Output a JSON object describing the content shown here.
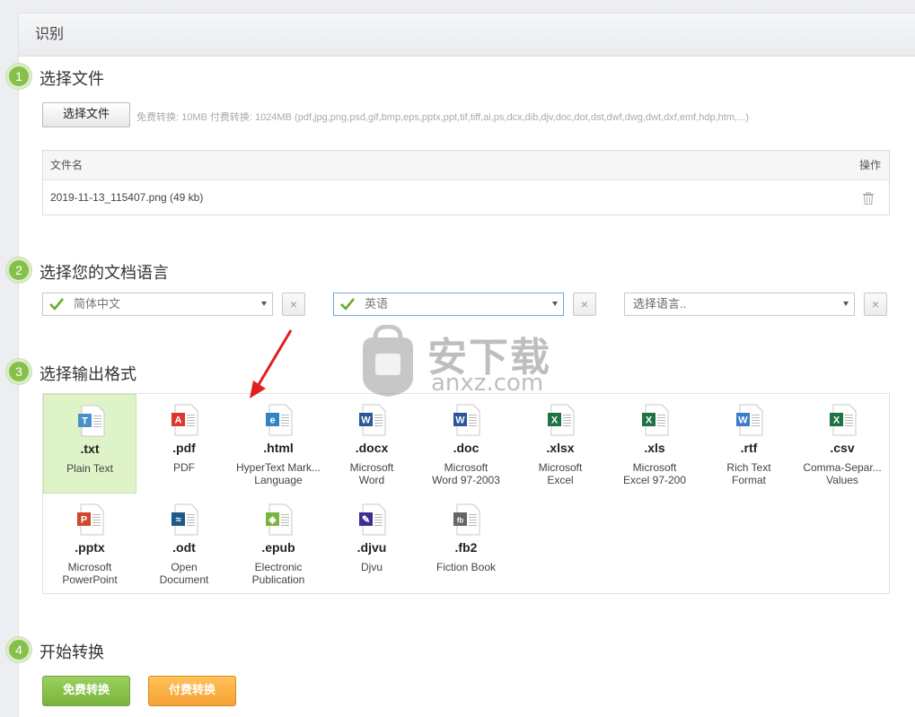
{
  "header": {
    "title": "识别"
  },
  "step1": {
    "number": "1",
    "title": "选择文件",
    "choose_label": "选择文件",
    "limits": "免费转换: 10MB  付费转换: 1024MB   (pdf,jpg,png,psd,gif,bmp,eps,pptx,ppt,tif,tiff,ai,ps,dcx,dib,djv,doc,dot,dst,dwf,dwg,dwt,dxf,emf,hdp,htm,...)",
    "table": {
      "col_name": "文件名",
      "col_action": "操作",
      "rows": [
        {
          "name": "2019-11-13_115407.png (49 kb)"
        }
      ]
    }
  },
  "step2": {
    "number": "2",
    "title": "选择您的文档语言",
    "selects": [
      {
        "value": "简体中文"
      },
      {
        "value": "英语"
      },
      {
        "value": "选择语言.."
      }
    ],
    "clear_label": "×"
  },
  "step3": {
    "number": "3",
    "title": "选择输出格式",
    "formats": [
      {
        "ext": ".txt",
        "line1": "Plain Text",
        "line2": "",
        "icon": "txt-file-icon",
        "color": "#4a90c8",
        "letter": "T"
      },
      {
        "ext": ".pdf",
        "line1": "PDF",
        "line2": "",
        "icon": "pdf-file-icon",
        "color": "#d9382f",
        "letter": "A"
      },
      {
        "ext": ".html",
        "line1": "HyperText Mark...",
        "line2": "Language",
        "icon": "html-file-icon",
        "color": "#2f86c7",
        "letter": "e"
      },
      {
        "ext": ".docx",
        "line1": "Microsoft",
        "line2": "Word",
        "icon": "word-file-icon",
        "color": "#2b5797",
        "letter": "W"
      },
      {
        "ext": ".doc",
        "line1": "Microsoft",
        "line2": "Word 97-2003",
        "icon": "word-file-icon",
        "color": "#2b5797",
        "letter": "W"
      },
      {
        "ext": ".xlsx",
        "line1": "Microsoft",
        "line2": "Excel",
        "icon": "excel-file-icon",
        "color": "#1f7244",
        "letter": "X"
      },
      {
        "ext": ".xls",
        "line1": "Microsoft",
        "line2": "Excel 97-200",
        "icon": "excel-file-icon",
        "color": "#1f7244",
        "letter": "X"
      },
      {
        "ext": ".rtf",
        "line1": "Rich Text",
        "line2": "Format",
        "icon": "rtf-file-icon",
        "color": "#3a7dc9",
        "letter": "W"
      },
      {
        "ext": ".csv",
        "line1": "Comma-Separ...",
        "line2": "Values",
        "icon": "csv-file-icon",
        "color": "#1f7244",
        "letter": "X"
      },
      {
        "ext": ".pptx",
        "line1": "Microsoft",
        "line2": "PowerPoint",
        "icon": "powerpoint-file-icon",
        "color": "#d0472b",
        "letter": "P"
      },
      {
        "ext": ".odt",
        "line1": "Open",
        "line2": "Document",
        "icon": "odt-file-icon",
        "color": "#1d5a8a",
        "letter": "≈"
      },
      {
        "ext": ".epub",
        "line1": "Electronic",
        "line2": "Publication",
        "icon": "epub-file-icon",
        "color": "#7ab33d",
        "letter": "◈"
      },
      {
        "ext": ".djvu",
        "line1": "Djvu",
        "line2": "",
        "icon": "djvu-file-icon",
        "color": "#3b2f8f",
        "letter": "✎"
      },
      {
        "ext": ".fb2",
        "line1": "Fiction Book",
        "line2": "",
        "icon": "fb2-file-icon",
        "color": "#666666",
        "letter": "fb"
      }
    ]
  },
  "step4": {
    "number": "4",
    "title": "开始转换",
    "free_label": "免费转换",
    "paid_label": "付费转换"
  },
  "watermark": {
    "text": "安下载",
    "sub": "anxz.com"
  },
  "colors": {
    "step_green": "#85c14a",
    "selected_bg": "#dff3c8",
    "free_btn": "#85c14a",
    "paid_btn": "#f5a232",
    "arrow": "#e02020"
  }
}
